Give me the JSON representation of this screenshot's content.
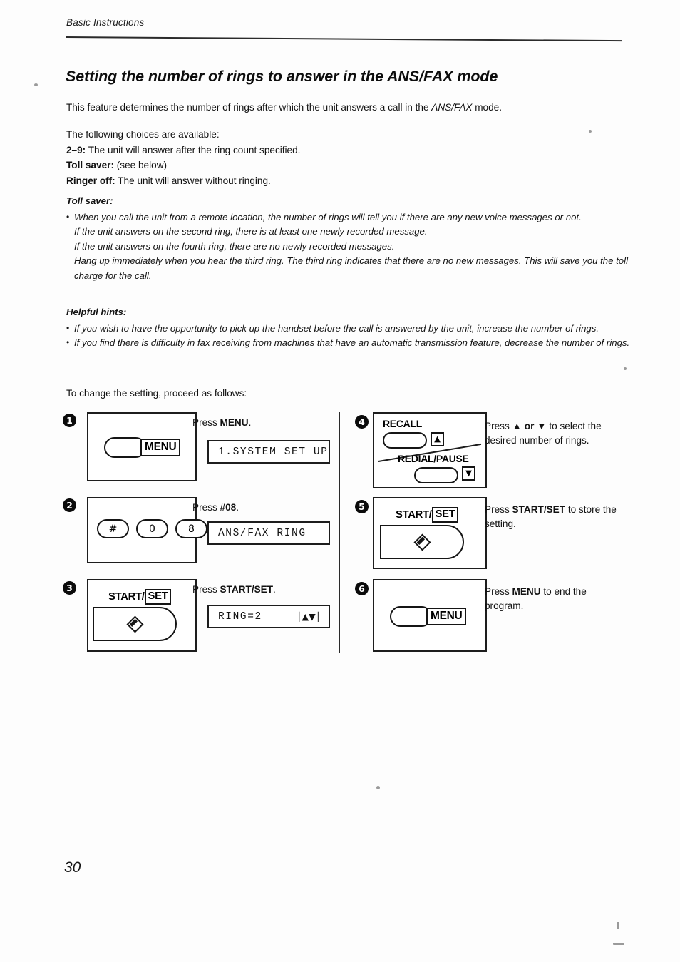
{
  "document": {
    "running_head": "Basic Instructions",
    "title": "Setting the number of rings to answer in the ANS/FAX mode",
    "page_number": "30"
  },
  "intro": {
    "before": "This feature determines the number of rings after which the unit answers a call in the ",
    "emphasis": "ANS/FAX",
    "after": " mode."
  },
  "choices": {
    "lead": "The following choices are available:",
    "items": [
      {
        "label": "2–9:",
        "text": "The unit will answer after the ring count specified."
      },
      {
        "label": "Toll saver:",
        "text": "(see below)"
      },
      {
        "label": "Ringer off:",
        "text": "The unit will answer without ringing."
      }
    ]
  },
  "toll_saver": {
    "heading": "Toll saver:",
    "bullet": "When you call the unit from a remote location, the number of rings will tell you if there are any new voice messages or not.",
    "lines": [
      "If the unit answers on the second ring, there is at least one newly recorded message.",
      "If the unit answers on the fourth ring, there are no newly recorded messages.",
      "Hang up immediately when you hear the third ring. The third ring indicates that there are no new messages. This will save you the toll charge for the call."
    ]
  },
  "helpful_hints": {
    "heading": "Helpful hints:",
    "bullets": [
      "If you wish to have the opportunity to pick up the handset before the call is answered by the unit, increase the number of rings.",
      "If you find there is difficulty in fax receiving from machines that have an automatic transmission feature, decrease the number of rings."
    ]
  },
  "procedure_lead": "To change the setting, proceed as follows:",
  "steps": [
    {
      "number": "1",
      "instruction_before": "Press ",
      "instruction_bold": "MENU",
      "instruction_after": ".",
      "key_label": "MENU",
      "display": "1.SYSTEM SET UP"
    },
    {
      "number": "2",
      "instruction_before": "Press ",
      "instruction_bold": "#08",
      "instruction_after": ".",
      "keys": [
        "#",
        "0",
        "8"
      ],
      "display": "ANS/FAX RING"
    },
    {
      "number": "3",
      "instruction_before": "Press ",
      "instruction_bold": "START/SET",
      "instruction_after": ".",
      "key_label_a": "START/",
      "key_label_b": "SET",
      "display": "RING=2",
      "display_arrows_open": "│",
      "display_arrows": "▲▼",
      "display_arrows_close": "│"
    },
    {
      "number": "4",
      "instruction_before": "Press ",
      "instruction_bold": "▲ or ▼",
      "instruction_after": " to select the desired number of rings.",
      "recall_label": "RECALL",
      "up_arrow": "▲",
      "redial_label": "REDIAL/PAUSE",
      "down_arrow": "▼"
    },
    {
      "number": "5",
      "instruction_before": "Press ",
      "instruction_bold": "START/SET",
      "instruction_after": " to store the setting.",
      "key_label_a": "START/",
      "key_label_b": "SET"
    },
    {
      "number": "6",
      "instruction_before": "Press ",
      "instruction_bold": "MENU",
      "instruction_after": " to end the program.",
      "key_label": "MENU"
    }
  ]
}
